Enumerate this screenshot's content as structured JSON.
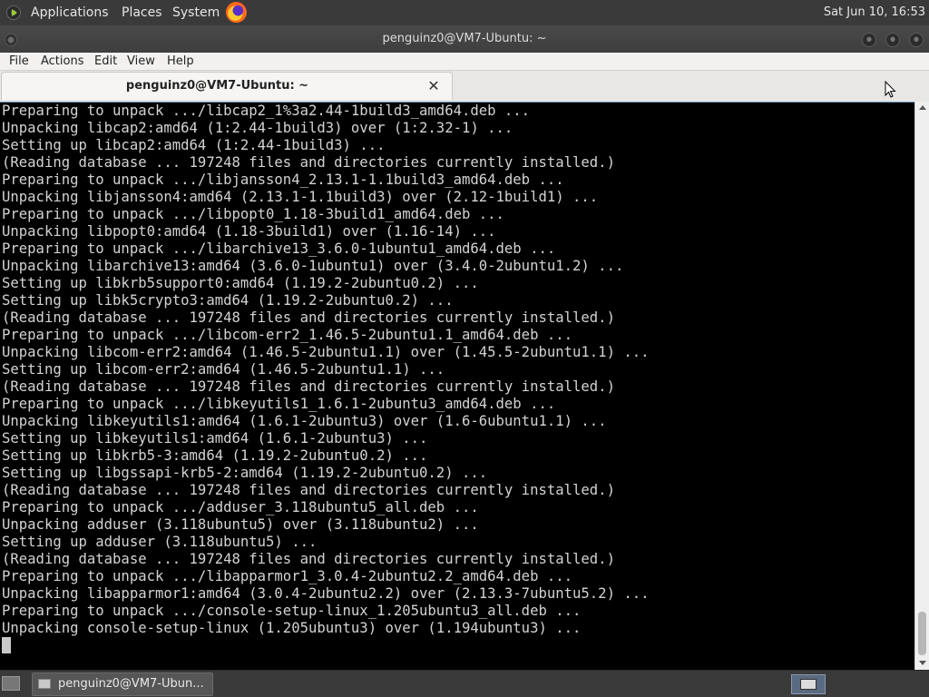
{
  "top_panel": {
    "menus": [
      "Applications",
      "Places",
      "System"
    ],
    "clock": "Sat Jun 10, 16:53",
    "launcher_icon": "firefox-icon"
  },
  "window": {
    "title": "penguinz0@VM7-Ubuntu: ~"
  },
  "menubar": {
    "items": [
      "File",
      "Actions",
      "Edit",
      "View",
      "Help"
    ]
  },
  "tabs": [
    {
      "label": "penguinz0@VM7-Ubuntu: ~",
      "close_icon": "close-icon"
    }
  ],
  "terminal": {
    "lines": [
      "Preparing to unpack .../libcap2_1%3a2.44-1build3_amd64.deb ...",
      "Unpacking libcap2:amd64 (1:2.44-1build3) over (1:2.32-1) ...",
      "Setting up libcap2:amd64 (1:2.44-1build3) ...",
      "(Reading database ... 197248 files and directories currently installed.)",
      "Preparing to unpack .../libjansson4_2.13.1-1.1build3_amd64.deb ...",
      "Unpacking libjansson4:amd64 (2.13.1-1.1build3) over (2.12-1build1) ...",
      "Preparing to unpack .../libpopt0_1.18-3build1_amd64.deb ...",
      "Unpacking libpopt0:amd64 (1.18-3build1) over (1.16-14) ...",
      "Preparing to unpack .../libarchive13_3.6.0-1ubuntu1_amd64.deb ...",
      "Unpacking libarchive13:amd64 (3.6.0-1ubuntu1) over (3.4.0-2ubuntu1.2) ...",
      "Setting up libkrb5support0:amd64 (1.19.2-2ubuntu0.2) ...",
      "Setting up libk5crypto3:amd64 (1.19.2-2ubuntu0.2) ...",
      "(Reading database ... 197248 files and directories currently installed.)",
      "Preparing to unpack .../libcom-err2_1.46.5-2ubuntu1.1_amd64.deb ...",
      "Unpacking libcom-err2:amd64 (1.46.5-2ubuntu1.1) over (1.45.5-2ubuntu1.1) ...",
      "Setting up libcom-err2:amd64 (1.46.5-2ubuntu1.1) ...",
      "(Reading database ... 197248 files and directories currently installed.)",
      "Preparing to unpack .../libkeyutils1_1.6.1-2ubuntu3_amd64.deb ...",
      "Unpacking libkeyutils1:amd64 (1.6.1-2ubuntu3) over (1.6-6ubuntu1.1) ...",
      "Setting up libkeyutils1:amd64 (1.6.1-2ubuntu3) ...",
      "Setting up libkrb5-3:amd64 (1.19.2-2ubuntu0.2) ...",
      "Setting up libgssapi-krb5-2:amd64 (1.19.2-2ubuntu0.2) ...",
      "(Reading database ... 197248 files and directories currently installed.)",
      "Preparing to unpack .../adduser_3.118ubuntu5_all.deb ...",
      "Unpacking adduser (3.118ubuntu5) over (3.118ubuntu2) ...",
      "Setting up adduser (3.118ubuntu5) ...",
      "(Reading database ... 197248 files and directories currently installed.)",
      "Preparing to unpack .../libapparmor1_3.0.4-2ubuntu2.2_amd64.deb ...",
      "Unpacking libapparmor1:amd64 (3.0.4-2ubuntu2.2) over (2.13.3-7ubuntu5.2) ...",
      "Preparing to unpack .../console-setup-linux_1.205ubuntu3_all.deb ...",
      "Unpacking console-setup-linux (1.205ubuntu3) over (1.194ubuntu3) ..."
    ],
    "colors": {
      "background": "#000000",
      "foreground": "#d3d3d3"
    }
  },
  "taskbar": {
    "task_label": "penguinz0@VM7-Ubun..."
  }
}
